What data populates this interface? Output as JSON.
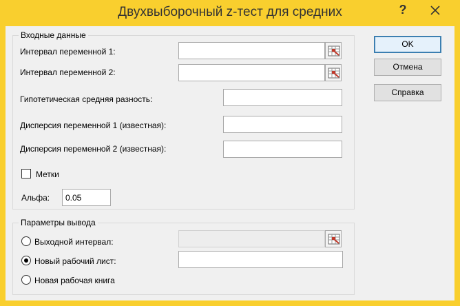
{
  "window": {
    "title": "Двухвыборочный z-тест для средних",
    "help_glyph": "?",
    "close_icon": "close-icon",
    "frame_color": "#f9cf2e"
  },
  "input_group": {
    "legend": "Входные данные",
    "range1_label": "Интервал переменной 1:",
    "range1_value": "",
    "range2_label": "Интервал переменной 2:",
    "range2_value": "",
    "hyp_diff_label": "Гипотетическая средняя разность:",
    "hyp_diff_value": "",
    "var1_label": " Дисперсия переменной 1 (известная):",
    "var1_value": "",
    "var2_label": "Дисперсия переменной 2 (известная):",
    "var2_value": "",
    "labels_checkbox_label": "Метки",
    "labels_checked": false,
    "alpha_label": "Альфа:",
    "alpha_value": "0.05"
  },
  "output_group": {
    "legend": "Параметры вывода",
    "output_range_label": "Выходной интервал:",
    "output_range_value": "",
    "new_sheet_label": "Новый рабочий лист:",
    "new_sheet_value": "",
    "new_workbook_label": "Новая рабочая книга",
    "selected": "new_sheet"
  },
  "buttons": {
    "ok": "OK",
    "cancel": "Отмена",
    "help": "Справка"
  },
  "icons": {
    "range_picker": "range-picker-icon"
  }
}
